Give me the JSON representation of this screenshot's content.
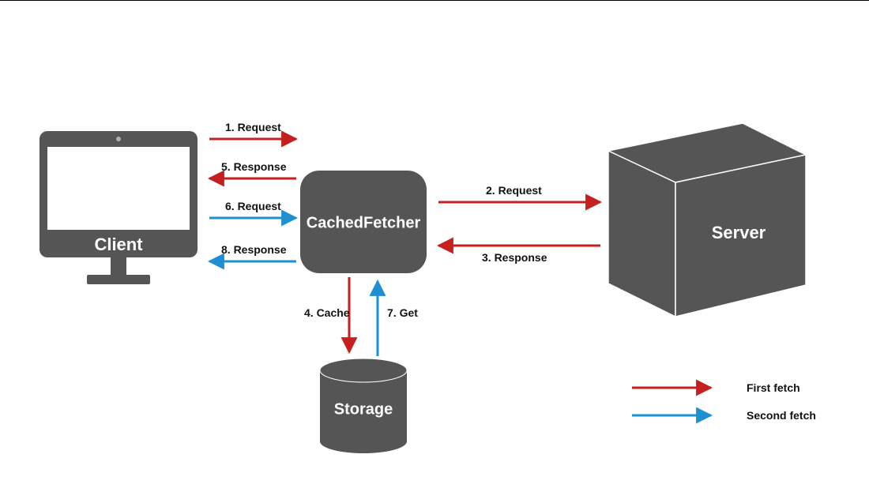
{
  "nodes": {
    "client": {
      "label": "Client"
    },
    "cached_fetcher": {
      "label": "CachedFetcher"
    },
    "server": {
      "label": "Server"
    },
    "storage": {
      "label": "Storage"
    }
  },
  "edges": {
    "e1": {
      "label": "1. Request"
    },
    "e2": {
      "label": "2. Request"
    },
    "e3": {
      "label": "3. Response"
    },
    "e4": {
      "label": "4. Cache"
    },
    "e5": {
      "label": "5. Response"
    },
    "e6": {
      "label": "6. Request"
    },
    "e7": {
      "label": "7. Get"
    },
    "e8": {
      "label": "8. Response"
    }
  },
  "legend": {
    "first": {
      "label": "First fetch",
      "color": "#c61f1f"
    },
    "second": {
      "label": "Second fetch",
      "color": "#1e90d2"
    }
  },
  "colors": {
    "node_fill": "#555555",
    "first": "#c61f1f",
    "second": "#1e90d2"
  }
}
